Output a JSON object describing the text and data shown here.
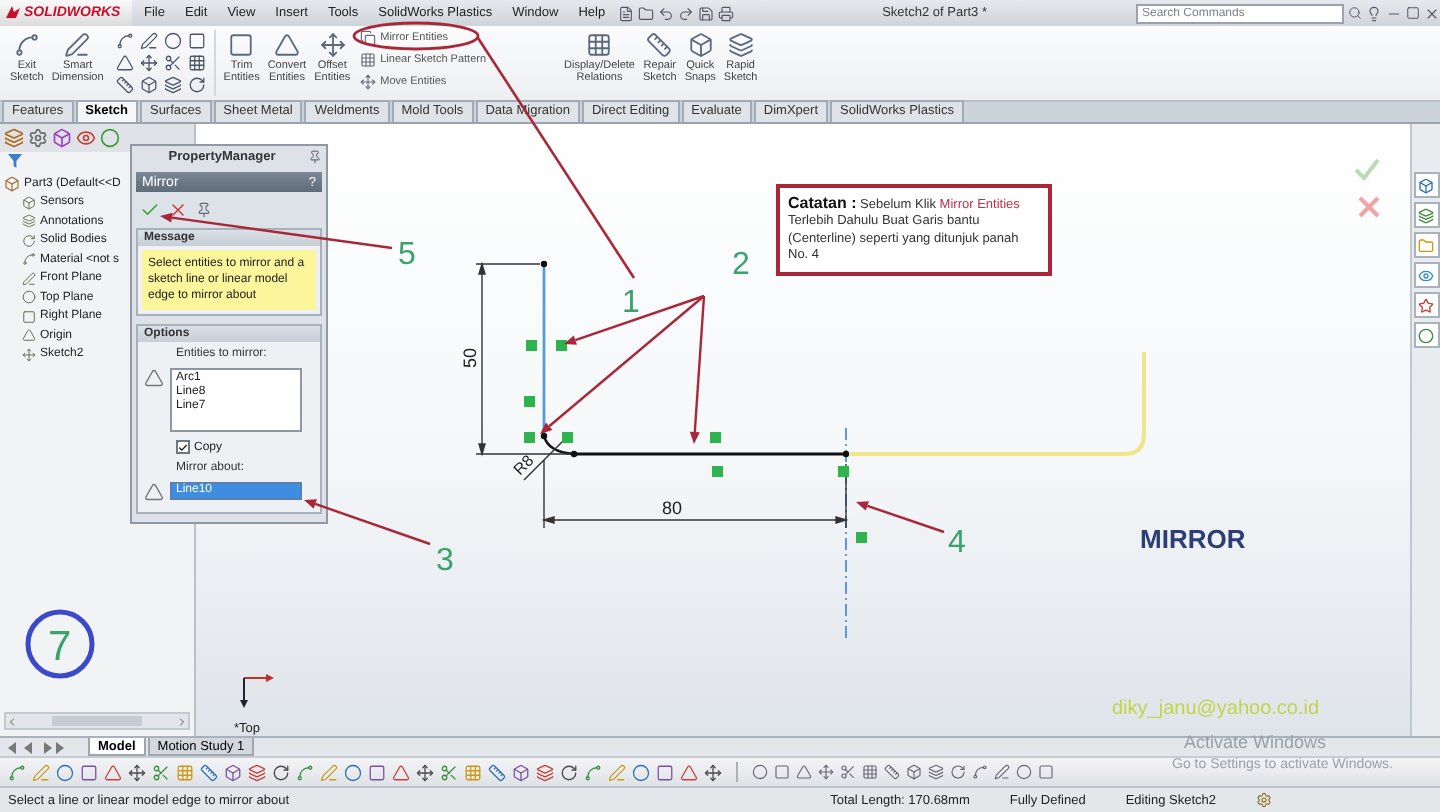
{
  "app": {
    "logo": "SOLIDWORKS",
    "menu": [
      "File",
      "Edit",
      "View",
      "Insert",
      "Tools",
      "SolidWorks Plastics",
      "Window",
      "Help"
    ],
    "title": "Sketch2 of Part3 *",
    "search": {
      "placeholder": "Search Commands"
    }
  },
  "ribbon": [
    {
      "kind": "large",
      "label": "Exit Sketch"
    },
    {
      "kind": "large",
      "label": "Smart Dimension"
    },
    {
      "kind": "grid"
    },
    {
      "kind": "large",
      "label": "Trim Entities"
    },
    {
      "kind": "large",
      "label": "Convert Entities"
    },
    {
      "kind": "large",
      "label": "Offset Entities"
    },
    {
      "kind": "stack",
      "items": [
        "Mirror Entities",
        "Linear Sketch Pattern",
        "Move Entities"
      ]
    },
    {
      "kind": "large",
      "label": "Display/Delete Relations"
    },
    {
      "kind": "large",
      "label": "Repair Sketch"
    },
    {
      "kind": "large",
      "label": "Quick Snaps"
    },
    {
      "kind": "large",
      "label": "Rapid Sketch"
    }
  ],
  "tabs": [
    {
      "label": "Features",
      "selected": false
    },
    {
      "label": "Sketch",
      "selected": true
    },
    {
      "label": "Surfaces",
      "selected": false
    },
    {
      "label": "Sheet Metal",
      "selected": false
    },
    {
      "label": "Weldments",
      "selected": false
    },
    {
      "label": "Mold Tools",
      "selected": false
    },
    {
      "label": "Data Migration",
      "selected": false
    },
    {
      "label": "Direct Editing",
      "selected": false
    },
    {
      "label": "Evaluate",
      "selected": false
    },
    {
      "label": "DimXpert",
      "selected": false
    },
    {
      "label": "SolidWorks Plastics",
      "selected": false
    }
  ],
  "tree": {
    "label": "Part3  (Default<<D",
    "children": [
      {
        "label": "Sensors"
      },
      {
        "label": "Annotations"
      },
      {
        "label": "Solid Bodies"
      },
      {
        "label": "Material <not s"
      },
      {
        "label": "Front Plane"
      },
      {
        "label": "Top Plane"
      },
      {
        "label": "Right Plane"
      },
      {
        "label": "Origin"
      },
      {
        "label": "Sketch2"
      }
    ]
  },
  "property_manager": {
    "header": "PropertyManager",
    "title": "Mirror",
    "help": "?",
    "message": {
      "title": "Message",
      "text": "Select entities to mirror and a sketch line or linear model edge to mirror about"
    },
    "options": {
      "title": "Options",
      "entities_label": "Entities to mirror:",
      "entities": [
        "Arc1",
        "Line8",
        "Line7"
      ],
      "copy": {
        "label": "Copy",
        "checked": true
      },
      "mirror_about_label": "Mirror about:",
      "mirror_about": {
        "value": "Line10",
        "selected": true
      }
    }
  },
  "note": {
    "heading": "Catatan :",
    "lead": "Sebelum Klik",
    "highlight": "Mirror Entities",
    "body": "Terlebih Dahulu Buat Garis bantu (Centerline) seperti yang ditunjuk panah No. 4"
  },
  "sketch": {
    "dimensions": {
      "vertical": "50",
      "horizontal": "80",
      "radius": "R8"
    },
    "view": "*Top"
  },
  "callouts": [
    {
      "label": "1"
    },
    {
      "label": "2"
    },
    {
      "label": "3"
    },
    {
      "label": "4"
    },
    {
      "label": "5"
    }
  ],
  "step": "7",
  "caption": "MIRROR",
  "email": "diky_janu@yahoo.co.id",
  "activation_notice": [
    "Activate Windows",
    "Go to Settings to activate Windows."
  ],
  "bottom_tabs": [
    {
      "label": "Model",
      "selected": true
    },
    {
      "label": "Motion Study 1",
      "selected": false
    }
  ],
  "status_bar": {
    "prompt": "Select a line or linear model edge to mirror about",
    "length": "Total Length: 170.68mm",
    "state": "Fully Defined",
    "mode": "Editing Sketch2"
  }
}
